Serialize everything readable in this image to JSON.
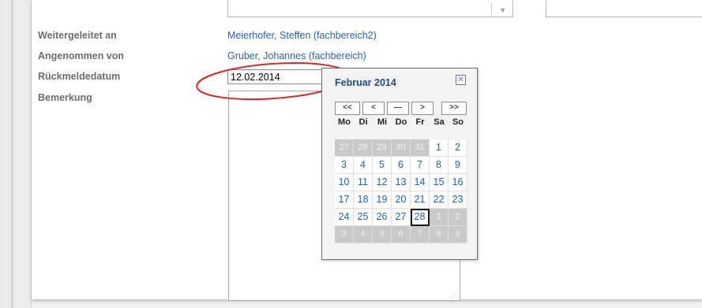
{
  "form": {
    "weitergeleitet_label": "Weitergeleitet an",
    "weitergeleitet_value": "Meierhofer, Steffen (fachbereich2)",
    "angenommen_label": "Angenommen von",
    "angenommen_value": "Gruber, Johannes (fachbereich)",
    "rueckmeldedatum_label": "Rückmeldedatum",
    "rueckmeldedatum_value": "12.02.2014",
    "bemerkung_label": "Bemerkung"
  },
  "calendar": {
    "title": "Februar 2014",
    "close_icon": "close-icon",
    "nav": {
      "prev_year": "<<",
      "prev_month": "<",
      "today": "—",
      "next_month": ">",
      "next_year": ">>"
    },
    "weekdays": [
      "Mo",
      "Di",
      "Mi",
      "Do",
      "Fr",
      "Sa",
      "So"
    ],
    "weeks": [
      [
        {
          "d": "27",
          "out": true
        },
        {
          "d": "28",
          "out": true
        },
        {
          "d": "29",
          "out": true
        },
        {
          "d": "30",
          "out": true
        },
        {
          "d": "31",
          "out": true
        },
        {
          "d": "1"
        },
        {
          "d": "2"
        }
      ],
      [
        {
          "d": "3"
        },
        {
          "d": "4"
        },
        {
          "d": "5"
        },
        {
          "d": "6"
        },
        {
          "d": "7"
        },
        {
          "d": "8"
        },
        {
          "d": "9"
        }
      ],
      [
        {
          "d": "10"
        },
        {
          "d": "11"
        },
        {
          "d": "12"
        },
        {
          "d": "13"
        },
        {
          "d": "14"
        },
        {
          "d": "15"
        },
        {
          "d": "16"
        }
      ],
      [
        {
          "d": "17"
        },
        {
          "d": "18"
        },
        {
          "d": "19"
        },
        {
          "d": "20"
        },
        {
          "d": "21"
        },
        {
          "d": "22"
        },
        {
          "d": "23"
        }
      ],
      [
        {
          "d": "24"
        },
        {
          "d": "25"
        },
        {
          "d": "26"
        },
        {
          "d": "27"
        },
        {
          "d": "28",
          "selected": true
        },
        {
          "d": "1",
          "out": true
        },
        {
          "d": "2",
          "out": true
        }
      ],
      [
        {
          "d": "3",
          "out": true
        },
        {
          "d": "4",
          "out": true
        },
        {
          "d": "5",
          "out": true
        },
        {
          "d": "6",
          "out": true
        },
        {
          "d": "7",
          "out": true
        },
        {
          "d": "8",
          "out": true
        },
        {
          "d": "9",
          "out": true
        }
      ]
    ]
  },
  "colors": {
    "link": "#2a64b0",
    "label": "#6d6d6d",
    "highlight": "#d42a2a",
    "calendar_title": "#1f4d8c"
  }
}
